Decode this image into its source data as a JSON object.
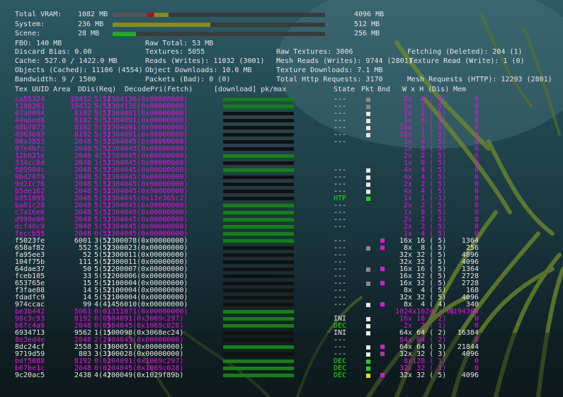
{
  "colors": {
    "magenta": "#d81ad8",
    "white": "#e8e8e8",
    "green": "#22d022",
    "bar_green": "#1e7a1e"
  },
  "stats": {
    "total_vram": {
      "label": "Total VRAM:",
      "value": "1082 MB",
      "max": "4096 MB"
    },
    "system": {
      "label": "System:",
      "value": "236 MB",
      "max": "512 MB"
    },
    "scene": {
      "label": "Scene:",
      "value": "28 MB",
      "max": "256 MB"
    },
    "fbo": "FBO: 140 MB",
    "raw_total": "Raw Total: 53 MB",
    "discard_bias": "Discard Bias: 0.00",
    "textures": "Textures: 5055",
    "raw_textures": "Raw Textures: 3006",
    "fetching": "Fetching (Deleted): 204 (1)",
    "cache": "Cache: 527.0 / 1422.0 MB",
    "reads": "Reads (Writes): 11032 (3001)",
    "mesh_reads": "Mesh Reads (Writes): 9744 (2801)",
    "texture_read": "Texture Read (Write): 1 (0)",
    "objects_cached": "Objects (Cached): 11106 (4554)",
    "object_downloads": "Object Downloads: 10.0 MB",
    "texture_downloads": "Texture Downloads: 7.1 MB",
    "bandwidth": "Bandwidth: 9 / 1500",
    "packets_bad": "Packets (Bad): 0 (0)",
    "http_requests": "Total Http Requests: 3170",
    "mesh_requests": "Mesh Requests (HTTP): 12293 (2801)"
  },
  "headers": {
    "uuid_area": "Tex UUID Area",
    "ddis": "DDis(Req)",
    "decode": "DecodePri(Fetch)",
    "download": "[download] pk/max",
    "state": "State",
    "pkt": "Pkt",
    "bnd": "Bnd",
    "wxh": "W x H (Dis)",
    "mem": "Mem"
  },
  "rows": [
    {
      "uuid": "ca55324",
      "area": "18432",
      "ddis": "5(5)",
      "decode": "2304136(0x00000000)",
      "state": "---",
      "pkt": "gray",
      "bnd": "",
      "wxh": "  8x  8 ( 5)",
      "mem": "0",
      "color": "magenta",
      "dl": 1.0
    },
    {
      "uuid": "f198261",
      "area": "18432",
      "ddis": "5(5)",
      "decode": "2304136(0x00000000)",
      "state": "---",
      "pkt": "gray",
      "bnd": "",
      "wxh": "  2x  2 ( 5)",
      "mem": "0",
      "color": "magenta",
      "dl": 1.0
    },
    {
      "uuid": "07a0094",
      "area": "8192",
      "ddis": "5(5)",
      "decode": "2304091(0x00000000)",
      "state": "---",
      "pkt": "white",
      "bnd": "",
      "wxh": "  2x  2 ( 5)",
      "mem": "0",
      "color": "magenta",
      "dl": 0
    },
    {
      "uuid": "44abed8",
      "area": "8192",
      "ddis": "5(5)",
      "decode": "2304091(0x00000000)",
      "state": "---",
      "pkt": "white",
      "bnd": "",
      "wxh": "  1x  8 ( 5)",
      "mem": "0",
      "color": "magenta",
      "dl": 0
    },
    {
      "uuid": "48b7873",
      "area": "8192",
      "ddis": "5(5)",
      "decode": "2304091(0x00000000)",
      "state": "---",
      "pkt": "white",
      "bnd": "",
      "wxh": " 16x  1 ( 5)",
      "mem": "0",
      "color": "magenta",
      "dl": 0
    },
    {
      "uuid": "4963603",
      "area": "8192",
      "ddis": "5(5)",
      "decode": "2304091(0x00000000)",
      "state": "---",
      "pkt": "white",
      "bnd": "",
      "wxh": " 16x  1 ( 5)",
      "mem": "0",
      "color": "magenta",
      "dl": 0
    },
    {
      "uuid": "00a3853",
      "area": "2048",
      "ddis": "5(5)",
      "decode": "2304045(0x00000000)",
      "state": "---",
      "pkt": "",
      "bnd": "",
      "wxh": "  1x  4 ( 5)",
      "mem": "0",
      "color": "magenta",
      "dl": 0
    },
    {
      "uuid": "07e4bfc",
      "area": "2048",
      "ddis": "5(5)",
      "decode": "2304045(0x00000000)",
      "state": "",
      "pkt": "",
      "bnd": "",
      "wxh": "  1x  8 ( 5)",
      "mem": "0",
      "color": "magenta",
      "dl": 0
    },
    {
      "uuid": "12b021e",
      "area": "2048",
      "ddis": "4(5)",
      "decode": "2304045(0x00000000)",
      "state": "",
      "pkt": "",
      "bnd": "",
      "wxh": "  2x  2 ( 5)",
      "mem": "0",
      "color": "magenta",
      "dl": 1.0
    },
    {
      "uuid": "334cc8d",
      "area": "2048",
      "ddis": "1(5)",
      "decode": "2304045(0x00000000)",
      "state": "",
      "pkt": "",
      "bnd": "",
      "wxh": "  1x  8 ( 5)",
      "mem": "0",
      "color": "magenta",
      "dl": 0
    },
    {
      "uuid": "589904c",
      "area": "2048",
      "ddis": "5(5)",
      "decode": "2304045(0x00000000)",
      "state": "---",
      "pkt": "white",
      "bnd": "",
      "wxh": "  4x  4 ( 5)",
      "mem": "0",
      "color": "magenta",
      "dl": 1.0
    },
    {
      "uuid": "9bd20f9",
      "area": "2048",
      "ddis": "5(5)",
      "decode": "2304045(0x00000000)",
      "state": "---",
      "pkt": "white",
      "bnd": "",
      "wxh": "  4x  4 ( 5)",
      "mem": "0",
      "color": "magenta",
      "dl": 0
    },
    {
      "uuid": "9d21c76",
      "area": "2048",
      "ddis": "5(5)",
      "decode": "2304045(0x00000000)",
      "state": "---",
      "pkt": "white",
      "bnd": "",
      "wxh": "  2x  2 ( 5)",
      "mem": "0",
      "color": "magenta",
      "dl": 0
    },
    {
      "uuid": "b5de162",
      "area": "2048",
      "ddis": "5(5)",
      "decode": "2304045(0x00000000)",
      "state": "---",
      "pkt": "white",
      "bnd": "",
      "wxh": "  4x  4 ( 5)",
      "mem": "0",
      "color": "magenta",
      "dl": 0
    },
    {
      "uuid": "b951095",
      "area": "2048",
      "ddis": "5(5)",
      "decode": "2304045(0x11e365c2)",
      "state": "HTP",
      "pkt": "green",
      "bnd": "",
      "wxh": "  1x  1 (-1)",
      "mem": "0",
      "color": "magenta",
      "dl": 0,
      "state_color": "green"
    },
    {
      "uuid": "ba81c28",
      "area": "2048",
      "ddis": "5(5)",
      "decode": "2304045(0x00000000)",
      "state": "---",
      "pkt": "",
      "bnd": "",
      "wxh": "  2x  2 ( 5)",
      "mem": "0",
      "color": "magenta",
      "dl": 1.0
    },
    {
      "uuid": "c7a16e6",
      "area": "2048",
      "ddis": "5(5)",
      "decode": "2304045(0x00000000)",
      "state": "---",
      "pkt": "",
      "bnd": "",
      "wxh": "  1x  8 ( 5)",
      "mem": "0",
      "color": "magenta",
      "dl": 1.0
    },
    {
      "uuid": "d999e06",
      "area": "2048",
      "ddis": "5(5)",
      "decode": "2304045(0x00000000)",
      "state": "---",
      "pkt": "",
      "bnd": "",
      "wxh": "  2x  2 ( 5)",
      "mem": "0",
      "color": "magenta",
      "dl": 1.0
    },
    {
      "uuid": "dcf40c9",
      "area": "2048",
      "ddis": "5(5)",
      "decode": "2304045(0x00000000)",
      "state": "---",
      "pkt": "",
      "bnd": "",
      "wxh": "  2x  2 ( 5)",
      "mem": "0",
      "color": "magenta",
      "dl": 1.0
    },
    {
      "uuid": "feccb55",
      "area": "2048",
      "ddis": "0(5)",
      "decode": "2304045(0x00000000)",
      "state": "",
      "pkt": "",
      "bnd": "",
      "wxh": "  1x  4 ( 5)",
      "mem": "0",
      "color": "magenta",
      "dl": 1.0
    },
    {
      "uuid": "f5023fe",
      "area": "6001",
      "ddis": "3(5)",
      "decode": "2300078(0x00000000)",
      "state": "---",
      "pkt": "",
      "bnd": "magenta",
      "wxh": " 16x 16 ( 5)",
      "mem": "1364",
      "color": "white",
      "dl": 1.0
    },
    {
      "uuid": "658af82",
      "area": "552",
      "ddis": "5(5)",
      "decode": "2300023(0x00000000)",
      "state": "---",
      "pkt": "gray",
      "bnd": "magenta",
      "wxh": "  8x  8 ( 5)",
      "mem": "256",
      "color": "white",
      "dl": 0
    },
    {
      "uuid": "fa95ee3",
      "area": "52",
      "ddis": "5(5)",
      "decode": "2300011(0x00000000)",
      "state": "---",
      "pkt": "",
      "bnd": "",
      "wxh": " 32x 32 ( 5)",
      "mem": "4096",
      "color": "white",
      "dl": 0
    },
    {
      "uuid": "104f75b",
      "area": "111",
      "ddis": "5(5)",
      "decode": "2300011(0x00000000)",
      "state": "---",
      "pkt": "",
      "bnd": "",
      "wxh": " 32x 32 ( 5)",
      "mem": "4096",
      "color": "white",
      "dl": 0
    },
    {
      "uuid": "64dae37",
      "area": "50",
      "ddis": "5(5)",
      "decode": "2200007(0x00000000)",
      "state": "---",
      "pkt": "gray",
      "bnd": "magenta",
      "wxh": " 16x 16 ( 5)",
      "mem": "1364",
      "color": "white",
      "dl": 0
    },
    {
      "uuid": "fceb105",
      "area": "33",
      "ddis": "5(5)",
      "decode": "2200006(0x00000000)",
      "state": "---",
      "pkt": "",
      "bnd": "",
      "wxh": " 16x 32 ( 5)",
      "mem": "2728",
      "color": "white",
      "dl": 0
    },
    {
      "uuid": "653765e",
      "area": "15",
      "ddis": "5(5)",
      "decode": "2100004(0x00000000)",
      "state": "---",
      "pkt": "gray",
      "bnd": "magenta",
      "wxh": " 16x 32 ( 5)",
      "mem": "2728",
      "color": "white",
      "dl": 0
    },
    {
      "uuid": "f3fae88",
      "area": "14",
      "ddis": "5(5)",
      "decode": "2100004(0x00000000)",
      "state": "---",
      "pkt": "",
      "bnd": "",
      "wxh": "  8x  4 ( 5)",
      "mem": "168",
      "color": "white",
      "dl": 0
    },
    {
      "uuid": "fdadfc9",
      "area": "14",
      "ddis": "5(5)",
      "decode": "2100004(0x00000000)",
      "state": "---",
      "pkt": "",
      "bnd": "",
      "wxh": " 32x 32 ( 5)",
      "mem": "4096",
      "color": "white",
      "dl": 0
    },
    {
      "uuid": "974ccac",
      "area": "99",
      "ddis": "4(4)",
      "decode": "1456010(0x00000000)",
      "state": "---",
      "pkt": "white",
      "bnd": "magenta",
      "wxh": "  8x  4 ( 4)",
      "mem": "340",
      "color": "white",
      "dl": 0
    },
    {
      "uuid": "be3b442",
      "area": "5061",
      "ddis": "0(0)",
      "decode": "1311071(0x00000000)",
      "state": "",
      "pkt": "",
      "bnd": "",
      "wxh": "1024x1024 ( 0)",
      "mem": "4194304",
      "color": "magenta",
      "dl": 1.0
    },
    {
      "uuid": "98c3c93",
      "area": "8192",
      "ddis": "0(0)",
      "decode": "504091(0x3069c297)",
      "state": "INI",
      "pkt": "white",
      "bnd": "",
      "wxh": " 16x 16 ( 2)",
      "mem": "0",
      "color": "magenta",
      "dl": 1.0
    },
    {
      "uuid": "b6fc4a9",
      "area": "2048",
      "ddis": "0(0)",
      "decode": "504045(0x1069c028)",
      "state": "DEC",
      "pkt": "white",
      "bnd": "",
      "wxh": "  2x  2 ( 1)",
      "mem": "0",
      "color": "magenta",
      "dl": 1.0,
      "state_color": "green"
    },
    {
      "uuid": "6934713",
      "area": "9562",
      "ddis": "1(1)",
      "decode": "500098(0x3068ec24)",
      "state": "INI",
      "pkt": "white",
      "bnd": "",
      "wxh": " 64x 64 ( 2)",
      "mem": "16384",
      "color": "white",
      "dl": 0
    },
    {
      "uuid": "8e3ed4e",
      "area": "2048",
      "ddis": "2(2)",
      "decode": "404045(0x00000000)",
      "state": "---",
      "pkt": "",
      "bnd": "",
      "wxh": " 64x 64 ( 2)",
      "mem": "0",
      "color": "magenta",
      "dl": 0
    },
    {
      "uuid": "8dc24cf",
      "area": "2558",
      "ddis": "3(3)",
      "decode": "300051(0x00000000)",
      "state": "---",
      "pkt": "white",
      "bnd": "magenta",
      "wxh": " 64x 64 ( 3)",
      "mem": "21844",
      "color": "white",
      "dl": 1.0
    },
    {
      "uuid": "9719d59",
      "area": "803",
      "ddis": "3(3)",
      "decode": "300028(0x00000000)",
      "state": "---",
      "pkt": "white",
      "bnd": "purple",
      "wxh": " 32x 32 ( 3)",
      "mem": "4096",
      "color": "white",
      "dl": 0
    },
    {
      "uuid": "bdf5088",
      "area": "8192",
      "ddis": "0(0)",
      "decode": "204091(0x1069c297)",
      "state": "DEC",
      "pkt": "green",
      "bnd": "",
      "wxh": "  8x128 ( 1)",
      "mem": "0",
      "color": "magenta",
      "dl": 1.0,
      "state_color": "green"
    },
    {
      "uuid": "b67be1c",
      "area": "2048",
      "ddis": "0(0)",
      "decode": "204045(0x1069c028)",
      "state": "DEC",
      "pkt": "green",
      "bnd": "",
      "wxh": " 32x 32 ( 1)",
      "mem": "0",
      "color": "magenta",
      "dl": 1.0,
      "state_color": "green"
    },
    {
      "uuid": "9c20ac5",
      "area": "2438",
      "ddis": "4(4)",
      "decode": "200049(0x1029f89b)",
      "state": "DEC",
      "pkt": "yellow",
      "bnd": "magenta",
      "wxh": " 32x 32 ( 5)",
      "mem": "4096",
      "color": "white",
      "dl": 1.0,
      "state_color": "green"
    }
  ],
  "usage_bars": {
    "total_vram": {
      "fraction": 0.264
    },
    "system": {
      "fraction": 0.461
    },
    "scene": {
      "fraction": 0.109
    }
  }
}
